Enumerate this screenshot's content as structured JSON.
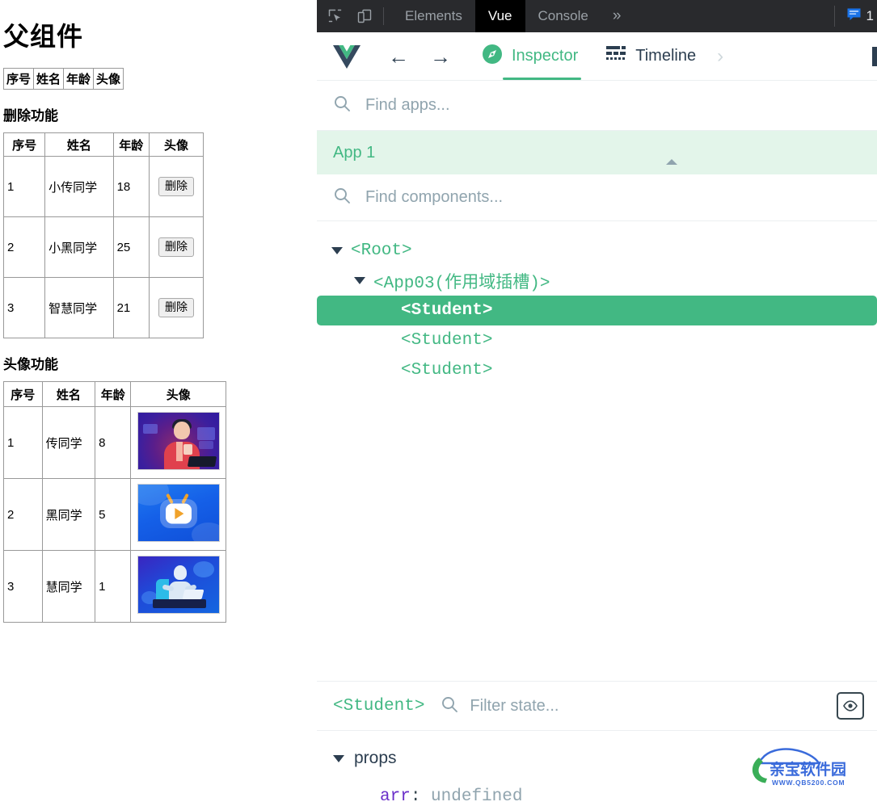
{
  "page": {
    "title": "父组件",
    "head_only_table": {
      "headers": [
        "序号",
        "姓名",
        "年龄",
        "头像"
      ]
    },
    "delete_section": {
      "heading": "删除功能",
      "headers": [
        "序号",
        "姓名",
        "年龄",
        "头像"
      ],
      "rows": [
        {
          "index": "1",
          "name": "小传同学",
          "age": "18",
          "action": "删除"
        },
        {
          "index": "2",
          "name": "小黑同学",
          "age": "25",
          "action": "删除"
        },
        {
          "index": "3",
          "name": "智慧同学",
          "age": "21",
          "action": "删除"
        }
      ]
    },
    "avatar_section": {
      "heading": "头像功能",
      "headers": [
        "序号",
        "姓名",
        "年龄",
        "头像"
      ],
      "rows": [
        {
          "index": "1",
          "name": "传同学",
          "age": "8",
          "avatar": "person-red-shirt-illustration"
        },
        {
          "index": "2",
          "name": "黑同学",
          "age": "5",
          "avatar": "tv-play-logo-illustration"
        },
        {
          "index": "3",
          "name": "慧同学",
          "age": "1",
          "avatar": "robot-laptop-illustration"
        }
      ]
    }
  },
  "devtools": {
    "topbar": {
      "inspect_icon": "inspect-element-icon",
      "device_icon": "device-toolbar-icon",
      "tabs": [
        {
          "label": "Elements",
          "active": false
        },
        {
          "label": "Vue",
          "active": true
        },
        {
          "label": "Console",
          "active": false
        }
      ],
      "more_label": "»",
      "message_icon": "message-icon",
      "message_count": "1"
    },
    "vue": {
      "logo": "vue-logo",
      "back_arrow": "←",
      "forward_arrow": "→",
      "tabs": [
        {
          "label": "Inspector",
          "icon": "compass-icon",
          "active": true
        },
        {
          "label": "Timeline",
          "icon": "timeline-icon",
          "active": false
        }
      ],
      "overflow_chevron": "›",
      "app_search_placeholder": "Find apps...",
      "selected_app": "App 1",
      "component_search_placeholder": "Find components...",
      "tree": [
        {
          "label": "<Root>",
          "depth": 1,
          "expandable": true,
          "selected": false
        },
        {
          "label": "<App03(作用域插槽)>",
          "depth": 2,
          "expandable": true,
          "selected": false
        },
        {
          "label": "<Student>",
          "depth": 3,
          "expandable": false,
          "selected": true
        },
        {
          "label": "<Student>",
          "depth": 3,
          "expandable": false,
          "selected": false
        },
        {
          "label": "<Student>",
          "depth": 3,
          "expandable": false,
          "selected": false
        }
      ],
      "state_panel": {
        "component_name": "<Student>",
        "filter_placeholder": "Filter state...",
        "eye_icon": "eye-icon",
        "groups": [
          {
            "name": "props",
            "entries": [
              {
                "key": "arr",
                "separator": ":",
                "value": "undefined"
              }
            ]
          }
        ]
      }
    }
  },
  "watermark": {
    "brand": "亲宝软件园",
    "url": "WWW.QB5200.COM",
    "colors": {
      "blue": "#2a5fd8",
      "green": "#2aa84a"
    }
  },
  "colors": {
    "vue_green": "#42b883",
    "vue_dark": "#2c3e50",
    "devtools_bg": "#292a2d",
    "selected_row": "#42b883",
    "app_row_bg": "#e3f5ea"
  }
}
